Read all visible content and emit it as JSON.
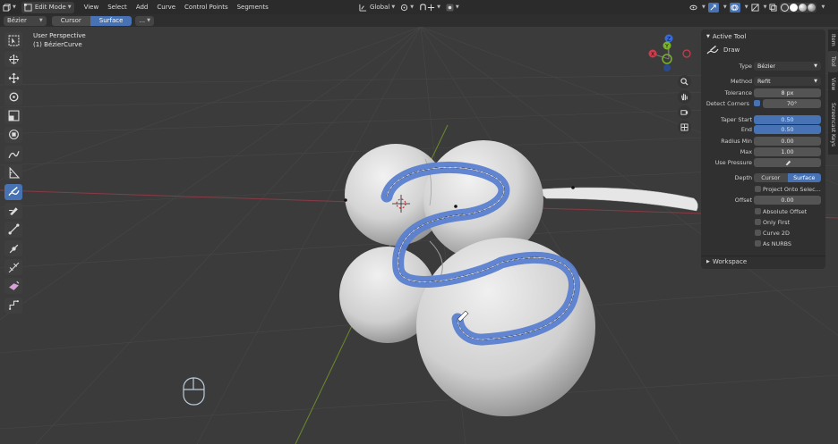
{
  "header": {
    "editor_type_icon": "3d-viewport-icon",
    "mode": "Edit Mode",
    "menus": [
      "View",
      "Select",
      "Add",
      "Curve",
      "Control Points",
      "Segments"
    ],
    "orientation": "Global"
  },
  "tool_settings": {
    "type": "Bézier",
    "depth_options": [
      "Cursor",
      "Surface"
    ],
    "depth_active": "Surface",
    "more": "..."
  },
  "viewport": {
    "perspective": "User Perspective",
    "object": "(1) BézierCurve"
  },
  "gizmo": {
    "z": "Z",
    "y": "Y",
    "x": "X"
  },
  "npanel": {
    "section": "Active Tool",
    "tool_name": "Draw",
    "type_label": "Type",
    "type_value": "Bézier",
    "method_label": "Method",
    "method_value": "Refit",
    "tolerance_label": "Tolerance",
    "tolerance_value": "8 px",
    "detect_corners_label": "Detect Corners",
    "detect_corners_value": "70°",
    "taper_start_label": "Taper Start",
    "taper_start_value": "0.50",
    "end_label": "End",
    "end_value": "0.50",
    "radius_min_label": "Radius Min",
    "radius_min_value": "0.00",
    "max_label": "Max",
    "max_value": "1.00",
    "use_pressure_label": "Use Pressure",
    "depth_label": "Depth",
    "depth_cursor": "Cursor",
    "depth_surface": "Surface",
    "project_onto": "Project Onto Selec...",
    "offset_label": "Offset",
    "offset_value": "0.00",
    "absolute_offset": "Absolute Offset",
    "only_first": "Only First",
    "curve_2d": "Curve 2D",
    "as_nurbs": "As NURBS",
    "workspace": "Workspace"
  },
  "tabs": [
    "Item",
    "Tool",
    "View",
    "Screencast Keys"
  ],
  "colors": {
    "accent": "#4772b3",
    "stroke": "#5a7fd0",
    "header": "#2b2b2b",
    "panel": "#303030"
  }
}
